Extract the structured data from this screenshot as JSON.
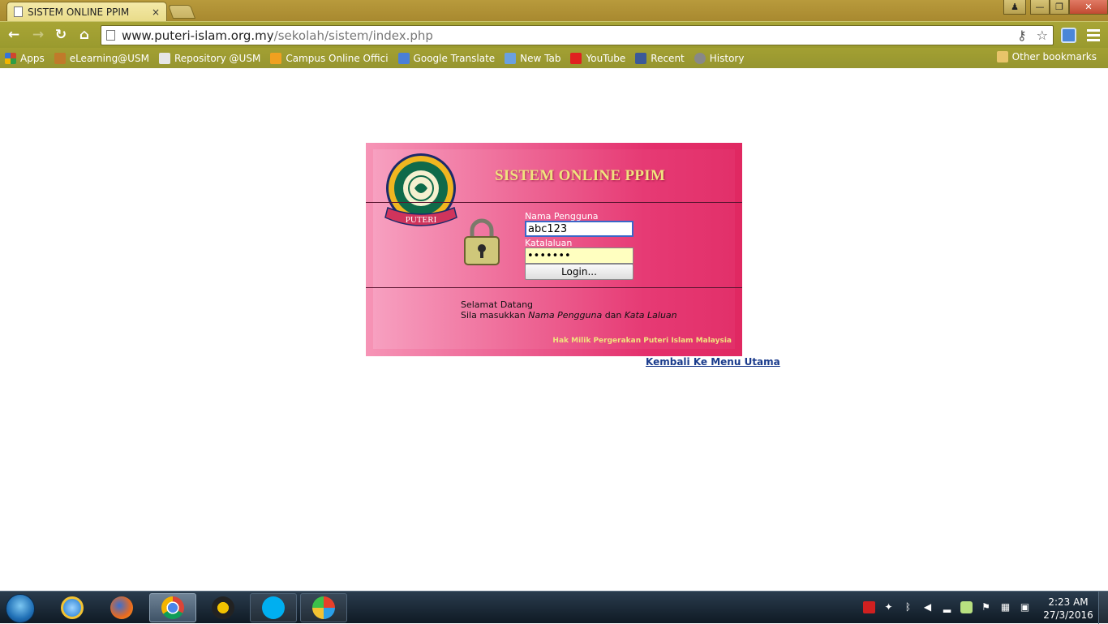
{
  "browser": {
    "tab_title": "SISTEM ONLINE PPIM",
    "tab_close": "×",
    "url_host": "www.puteri-islam.org.my",
    "url_path": "/sekolah/sistem/index.php",
    "bookmarks": [
      {
        "label": "Apps",
        "color": "#d0452d"
      },
      {
        "label": "eLearning@USM",
        "color": "#c07a2a"
      },
      {
        "label": "Repository @USM",
        "color": "#d8d8d8"
      },
      {
        "label": "Campus Online Offici",
        "color": "#f0a020"
      },
      {
        "label": "Google Translate",
        "color": "#4a7fd8"
      },
      {
        "label": "New Tab",
        "color": "#6aa0e0"
      },
      {
        "label": "YouTube",
        "color": "#e02020"
      },
      {
        "label": "Recent",
        "color": "#3b5998"
      },
      {
        "label": "History",
        "color": "#888888"
      }
    ],
    "other_bookmarks": "Other bookmarks"
  },
  "login": {
    "title": "SISTEM ONLINE PPIM",
    "logo_text": "PUTERI",
    "username_label": "Nama Pengguna",
    "username_value": "abc123",
    "password_label": "Katalaluan",
    "password_value": "•••••••",
    "login_button": "Login...",
    "welcome_line1": "Selamat Datang",
    "welcome_prefix": "Sila masukkan ",
    "welcome_user": "Nama Pengguna",
    "welcome_and": " dan ",
    "welcome_pass": "Kata Laluan",
    "copyright": "Hak Milik Pergerakan Puteri Islam Malaysia"
  },
  "page": {
    "back_link": "Kembali Ke Menu Utama"
  },
  "taskbar": {
    "time": "2:23 AM",
    "date": "27/3/2016"
  }
}
